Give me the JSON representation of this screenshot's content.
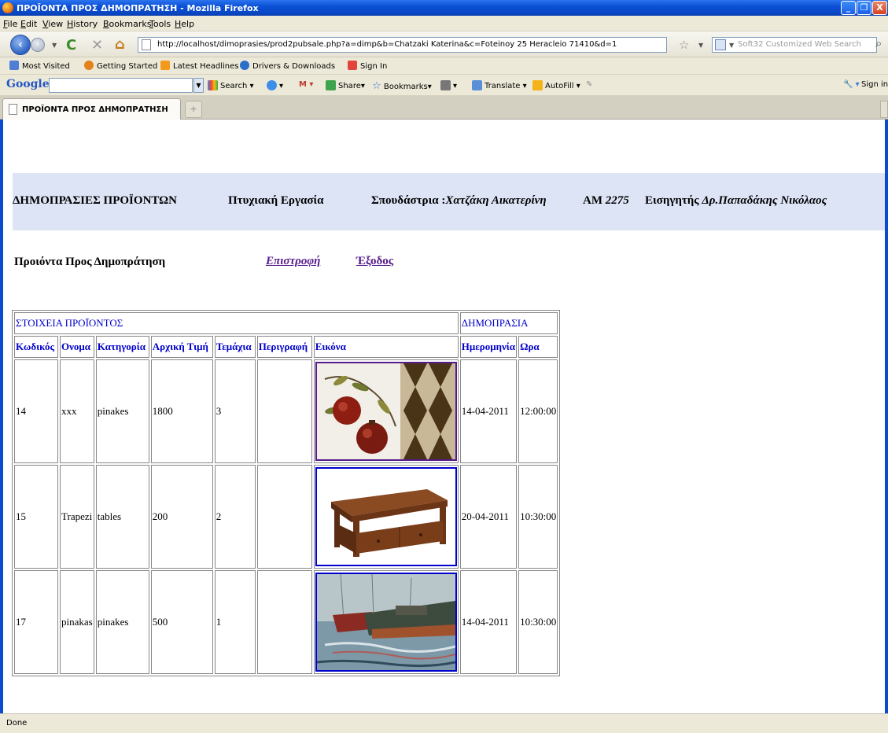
{
  "window": {
    "title": "ΠΡΟΪΟΝΤΑ ΠΡΟΣ ΔΗΜΟΠΡΑΤΗΣΗ - Mozilla Firefox",
    "minimize": "_",
    "maximize": "❐",
    "close": "X"
  },
  "menu": [
    "File",
    "Edit",
    "View",
    "History",
    "Bookmarks",
    "Tools",
    "Help"
  ],
  "nav": {
    "url": "http://localhost/dimoprasies/prod2pubsale.php?a=dimp&b=Chatzaki Katerina&c=Foteinoy 25 Heracleio 71410&d=1",
    "search_placeholder": "Soft32 Customized Web Search"
  },
  "bookmarks": [
    "Most Visited",
    "Getting Started",
    "Latest Headlines",
    "Drivers & Downloads",
    "Sign In"
  ],
  "google_toolbar": {
    "logo": "Google",
    "items": [
      "Search",
      "Share",
      "Bookmarks",
      "Translate",
      "AutoFill",
      "Sign in"
    ]
  },
  "tab": {
    "title": "ΠΡΟΪΟΝΤΑ ΠΡΟΣ ΔΗΜΟΠΡΑΤΗΣΗ",
    "new": "+"
  },
  "header": {
    "site": "ΔΗΜΟΠΡΑΣΙΕΣ ΠΡΟΪΟΝΤΩΝ",
    "project": "Πτυχιακή Εργασία",
    "student_label": "Σπουδάστρια :",
    "student_name": "Χατζάκη Αικατερίνη",
    "am_label": "ΑΜ",
    "am_value": "2275",
    "supervisor_label": "Εισηγητής",
    "supervisor_name": "Δρ.Παπαδάκης Νικόλαος"
  },
  "subheader": {
    "title": "Προιόντα Προς Δημοπράτηση",
    "back_link": "Επιστροφή",
    "exit_link": "Έξοδος"
  },
  "table": {
    "group_product": "ΣΤΟΙΧΕΙΑ ΠΡΟΪΟΝΤΟΣ",
    "group_auction": "ΔΗΜΟΠΡΑΣΙΑ",
    "columns": [
      "Κωδικός",
      "Ονομα",
      "Κατηγορία",
      "Αρχική Τιμή",
      "Τεμάχια",
      "Περιγραφή",
      "Εικόνα",
      "Ημερομηνία",
      "Ωρα"
    ],
    "rows": [
      {
        "code": "14",
        "name": "xxx",
        "category": "pinakes",
        "price": "1800",
        "pieces": "3",
        "description": "",
        "image": "painting-pomegranates",
        "date": "14-04-2011",
        "time": "12:00:00"
      },
      {
        "code": "15",
        "name": "Trapezi",
        "category": "tables",
        "price": "200",
        "pieces": "2",
        "description": "",
        "image": "wooden-coffee-table",
        "date": "20-04-2011",
        "time": "10:30:00"
      },
      {
        "code": "17",
        "name": "pinakas",
        "category": "pinakes",
        "price": "500",
        "pieces": "1",
        "description": "",
        "image": "painting-boats",
        "date": "14-04-2011",
        "time": "10:30:00"
      }
    ]
  },
  "status": "Done",
  "colors": {
    "link": "#0000cc",
    "visited": "#551a8b",
    "header_band": "#dde4f6",
    "title_bar": "#0b51d6"
  }
}
